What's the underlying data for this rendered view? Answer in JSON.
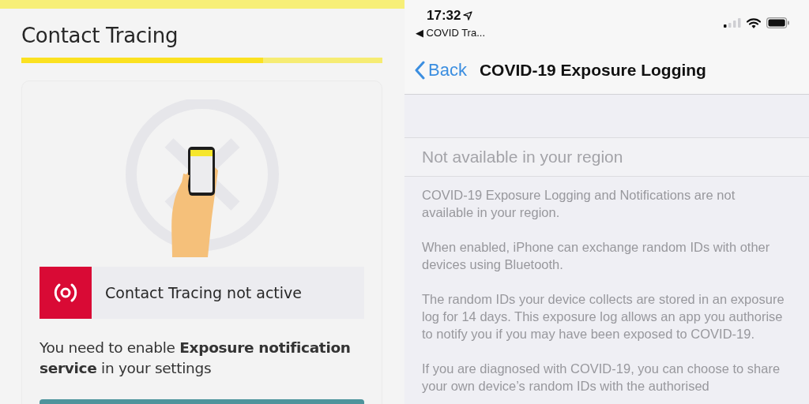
{
  "app": {
    "title": "Contact Tracing",
    "progress": {
      "level": 0.67
    },
    "status": {
      "label": "Contact Tracing not active",
      "active": false
    },
    "message": "You need to enable **Exposure notification service** in your settings"
  },
  "settings": {
    "status_bar": {
      "time": "17:32",
      "back_app": "◀ COVID Tra..."
    },
    "nav": {
      "back": "Back",
      "title": "COVID-19 Exposure Logging"
    },
    "cell": {
      "label": "Not available in your region",
      "disabled": true
    },
    "paragraphs": [
      "COVID-19 Exposure Logging and Notifications are not available in your region.",
      "When enabled, iPhone can exchange random IDs with other devices using Bluetooth.",
      "The random IDs your device collects are stored in an exposure log for 14 days. This exposure log allows an app you authorise to notify you if you may have been exposed to COVID-19.",
      "If you are diagnosed with COVID-19, you can choose to share your own device’s random IDs with the authorised"
    ]
  }
}
